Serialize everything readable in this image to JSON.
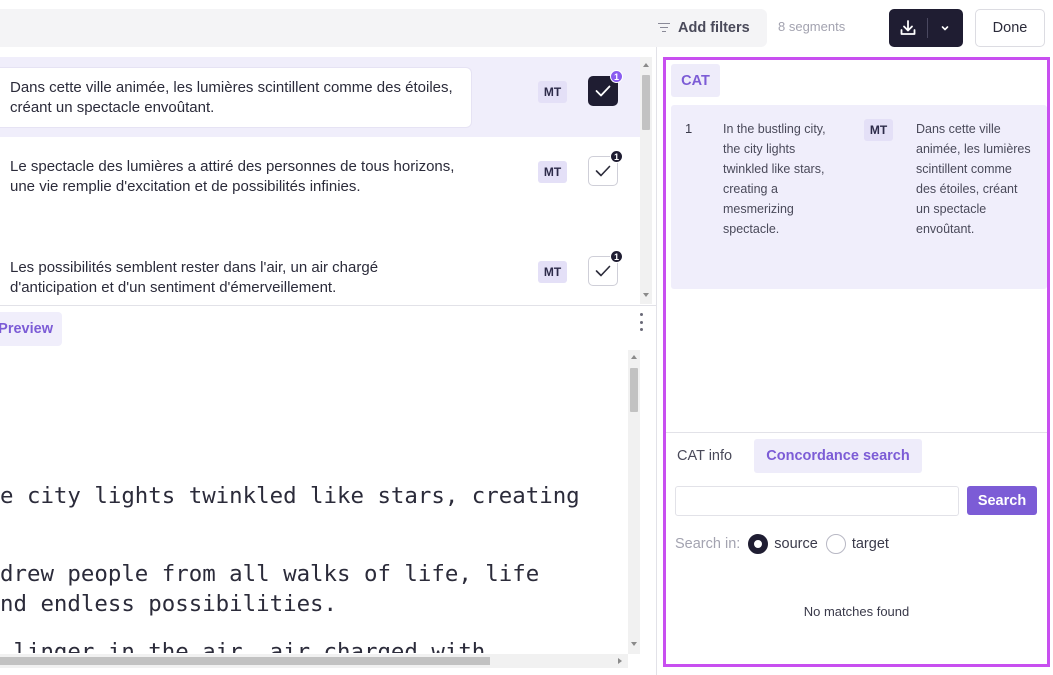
{
  "toolbar": {
    "add_filters_label": "Add filters",
    "segment_count": "8 segments",
    "done_label": "Done"
  },
  "segments": [
    {
      "text": "Dans cette ville animée, les lumières scintillent comme des étoiles, créant un spectacle envoûtant.",
      "badge": "MT",
      "count": "1",
      "confirmed": true,
      "active": true
    },
    {
      "text": "Le spectacle des lumières a attiré des personnes de tous horizons, une vie remplie d'excitation et de possibilités infinies.",
      "badge": "MT",
      "count": "1",
      "confirmed": false,
      "active": false
    },
    {
      "text": "Les possibilités semblent rester dans l'air, un air chargé d'anticipation et d'un sentiment d'émerveillement.",
      "badge": "MT",
      "count": "1",
      "confirmed": false,
      "active": false
    }
  ],
  "preview": {
    "tab_label": "Preview",
    "lines": [
      "e city lights twinkled like stars, creating",
      "",
      "drew people from all walks of life, life",
      "nd endless possibilities.",
      "",
      " linger in the air, air charged with"
    ]
  },
  "cat_panel": {
    "tab_label": "CAT",
    "match": {
      "number": "1",
      "source": "In the bustling city, the city lights twinkled like stars, creating a mesmerizing spectacle.",
      "badge": "MT",
      "target": "Dans cette ville animée, les lumières scintillent comme des étoiles, créant un spectacle envoûtant."
    },
    "tabs": {
      "info": "CAT info",
      "concordance": "Concordance search"
    },
    "search": {
      "value": "",
      "button_label": "Search",
      "search_in_label": "Search in:",
      "options": [
        "source",
        "target"
      ],
      "selected": "source"
    },
    "no_matches": "No matches found"
  },
  "colors": {
    "accent": "#7c5cd6",
    "highlight_border": "#c84ff0",
    "dark": "#1f1d32",
    "active_row": "#f0eefb"
  }
}
